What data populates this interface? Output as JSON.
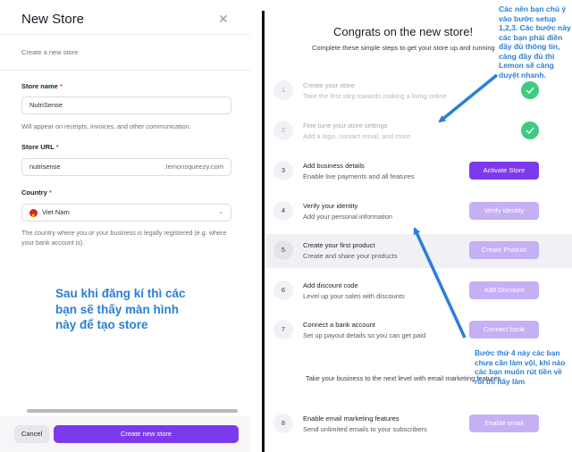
{
  "modal": {
    "title": "New Store",
    "subtitle": "Create a new store",
    "store_name": {
      "label": "Store name",
      "required": "*",
      "value": "NutriSense",
      "help": "Will appear on receipts, invoices, and other communication."
    },
    "store_url": {
      "label": "Store URL",
      "required": "*",
      "value": "nutrisense",
      "suffix": ".lemonsqueezy.com"
    },
    "country": {
      "label": "Country",
      "required": "*",
      "value": "Viet Nam",
      "help": "The country where you or your business is legally registered (e.g. where your bank account is)."
    },
    "cancel_label": "Cancel",
    "create_label": "Create new store"
  },
  "onboarding": {
    "title": "Congrats on the new store!",
    "subtitle": "Complete these simple steps to get your store up and running",
    "steps": [
      {
        "num": "1",
        "title": "Create your store",
        "desc": "Take the first step towards making a living online",
        "status": "done"
      },
      {
        "num": "2",
        "title": "Fine tune your store settings",
        "desc": "Add a logo, contact email, and more",
        "status": "done"
      },
      {
        "num": "3",
        "title": "Add business details",
        "desc": "Enable live payments and all features",
        "button": "Activate Store"
      },
      {
        "num": "4",
        "title": "Verify your identity",
        "desc": "Add your personal information",
        "button": "Verify identity"
      },
      {
        "num": "5",
        "title": "Create your first product",
        "desc": "Create and share your products",
        "button": "Create Product"
      },
      {
        "num": "6",
        "title": "Add discount code",
        "desc": "Level up your sales with discounts",
        "button": "Add Discount"
      },
      {
        "num": "7",
        "title": "Connect a bank account",
        "desc": "Set up payout details so you can get paid",
        "button": "Connect bank"
      }
    ],
    "marketing_text": "Take your business to the next level with email marketing features",
    "step8": {
      "num": "8",
      "title": "Enable email marketing features",
      "desc": "Send unlimited emails to your subscribers",
      "button": "Enable email"
    }
  },
  "annotations": {
    "left": "Sau khi đăng kí thì các bạn sẽ thấy màn hình này để tạo store",
    "top_right": "Các nên bạn chú ý vào bước setup 1,2,3. Các bước này các bạn phải điền đầy đủ thông tin, càng đầy đủ thì Lemon sẽ càng duyệt nhanh.",
    "bottom_right": "Bước thứ 4 này các bạn chưa cần làm vội, khi nào các bạn muốn rút tiền về rồi thì hãy làm"
  },
  "colors": {
    "primary": "#7c3aed",
    "primary_muted": "#c5b0f5",
    "success": "#3ccb7f",
    "annotation": "#2b7fd6"
  },
  "icons": {
    "close": "close-icon",
    "check": "check-icon",
    "flag": "vietnam-flag-icon",
    "chevron": "chevron-down-icon"
  }
}
